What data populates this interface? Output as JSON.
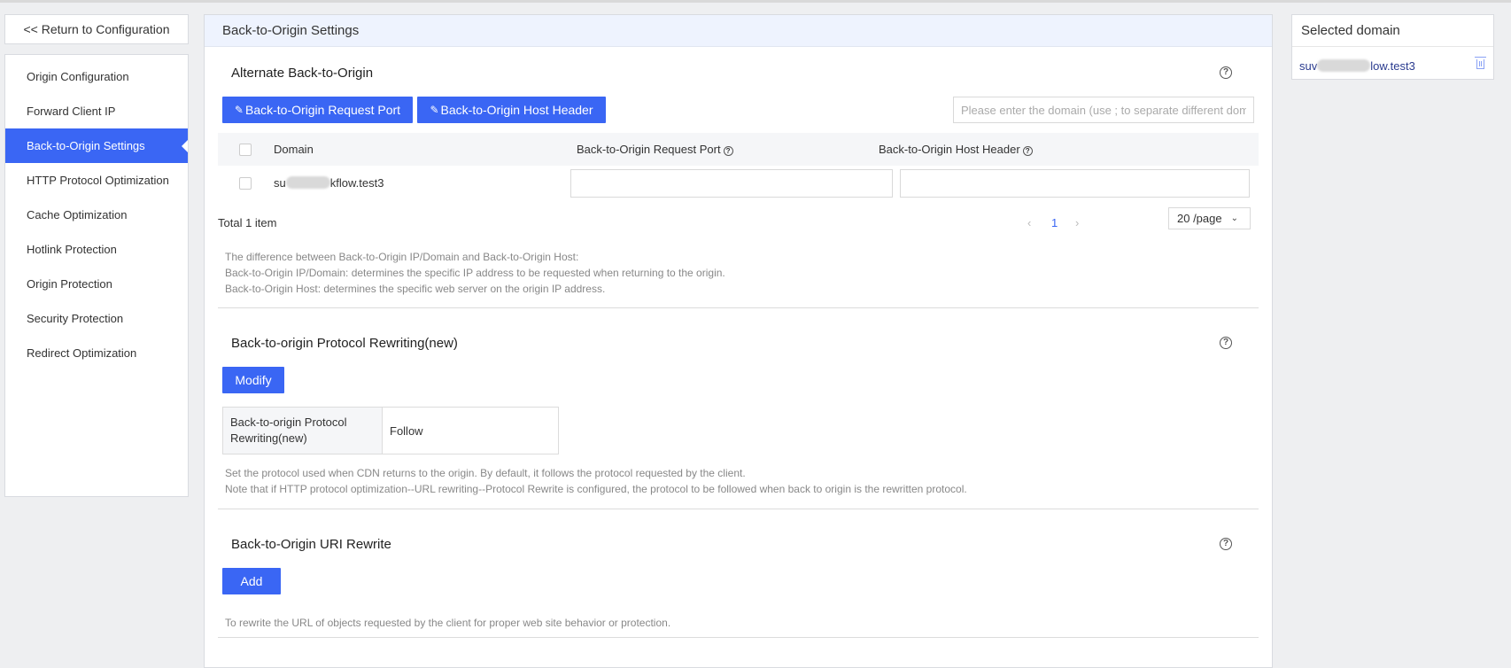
{
  "return_button": "<< Return to Configuration",
  "sidebar": {
    "items": [
      {
        "label": "Origin Configuration"
      },
      {
        "label": "Forward Client IP"
      },
      {
        "label": "Back-to-Origin Settings",
        "active": true
      },
      {
        "label": "HTTP Protocol Optimization"
      },
      {
        "label": "Cache Optimization"
      },
      {
        "label": "Hotlink Protection"
      },
      {
        "label": "Origin Protection"
      },
      {
        "label": "Security Protection"
      },
      {
        "label": "Redirect Optimization"
      }
    ]
  },
  "main": {
    "header": "Back-to-Origin Settings",
    "alternate": {
      "title": "Alternate Back-to-Origin",
      "help_icon": "?",
      "btn_port": "Back-to-Origin Request Port",
      "btn_host": "Back-to-Origin Host Header",
      "edit_icon": "✎",
      "search_placeholder": "Please enter the domain (use ; to separate different domains)",
      "table": {
        "columns": [
          "Domain",
          "Back-to-Origin Request Port",
          "Back-to-Origin Host Header"
        ],
        "rows": [
          {
            "domain_prefix": "su",
            "domain_suffix": "kflow.test3",
            "port": "",
            "host": ""
          }
        ]
      },
      "total": "Total 1 item",
      "pager": {
        "prev": "‹",
        "page": "1",
        "next": "›",
        "page_size": "20 /page",
        "chevron": "⌄"
      },
      "notes": [
        "The difference between Back-to-Origin IP/Domain and Back-to-Origin Host:",
        "Back-to-Origin IP/Domain: determines the specific IP address to be requested when returning to the origin.",
        "Back-to-Origin Host: determines the specific web server on the origin IP address."
      ]
    },
    "protocol": {
      "title": "Back-to-origin Protocol Rewriting(new)",
      "help_icon": "?",
      "btn_modify": "Modify",
      "key": "Back-to-origin Protocol Rewriting(new)",
      "value": "Follow",
      "notes": [
        "Set the protocol used when CDN returns to the origin. By default, it follows the protocol requested by the client.",
        "Note that if HTTP protocol optimization--URL rewriting--Protocol Rewrite is configured, the protocol to be followed when back to origin is the rewritten protocol."
      ]
    },
    "uri": {
      "title": "Back-to-Origin URI Rewrite",
      "help_icon": "?",
      "btn_add": "Add",
      "note": "To rewrite the URL of objects requested by the client for proper web site behavior or protection."
    }
  },
  "right": {
    "title": "Selected domain",
    "domain_prefix": "suv",
    "domain_suffix": "low.test3"
  },
  "colors": {
    "accent": "#3a66f4",
    "header_bg": "#eef3fe",
    "page_bg": "#eeeff1"
  }
}
